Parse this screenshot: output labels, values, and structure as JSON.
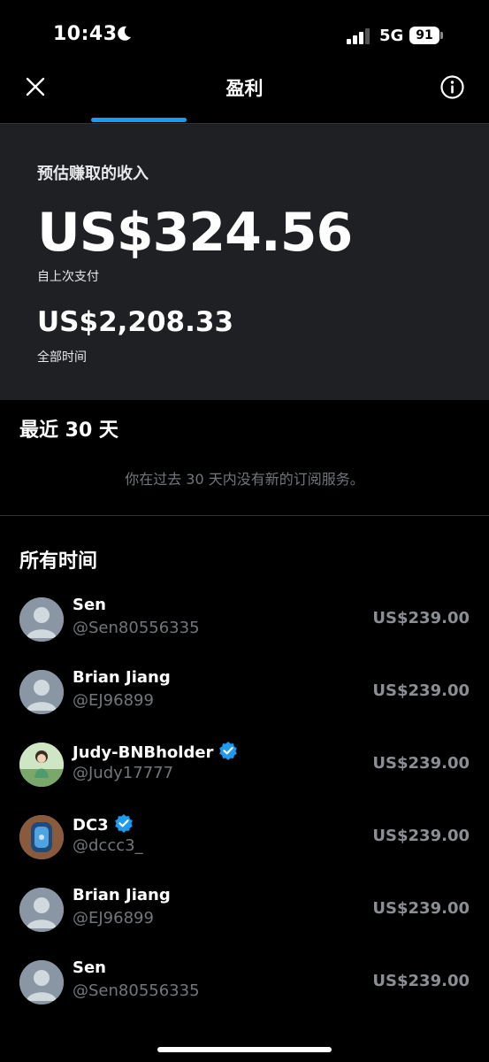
{
  "status_bar": {
    "time": "10:43",
    "network": "5G",
    "battery": "91"
  },
  "header": {
    "title": "盈利",
    "close_icon": "close-icon",
    "info_icon": "info-icon",
    "accent_color": "#1d9bf0"
  },
  "earnings": {
    "estimated_label": "预估赚取的收入",
    "since_last_payout_amount": "US$324.56",
    "since_last_payout_label": "自上次支付",
    "all_time_amount": "US$2,208.33",
    "all_time_label": "全部时间"
  },
  "recent": {
    "title": "最近 30 天",
    "empty_message": "你在过去 30 天内没有新的订阅服务。"
  },
  "all_time": {
    "title": "所有时间",
    "subscribers": [
      {
        "name": "Sen",
        "handle": "@Sen80556335",
        "amount": "US$239.00",
        "verified": false,
        "avatar": "default"
      },
      {
        "name": "Brian Jiang",
        "handle": "@EJ96899",
        "amount": "US$239.00",
        "verified": false,
        "avatar": "default"
      },
      {
        "name": "Judy-BNBholder",
        "handle": "@Judy17777",
        "amount": "US$239.00",
        "verified": true,
        "avatar": "photo-girl"
      },
      {
        "name": "DC3",
        "handle": "@dccc3_",
        "amount": "US$239.00",
        "verified": true,
        "avatar": "photo-watch"
      },
      {
        "name": "Brian Jiang",
        "handle": "@EJ96899",
        "amount": "US$239.00",
        "verified": false,
        "avatar": "default"
      },
      {
        "name": "Sen",
        "handle": "@Sen80556335",
        "amount": "US$239.00",
        "verified": false,
        "avatar": "default"
      }
    ]
  }
}
